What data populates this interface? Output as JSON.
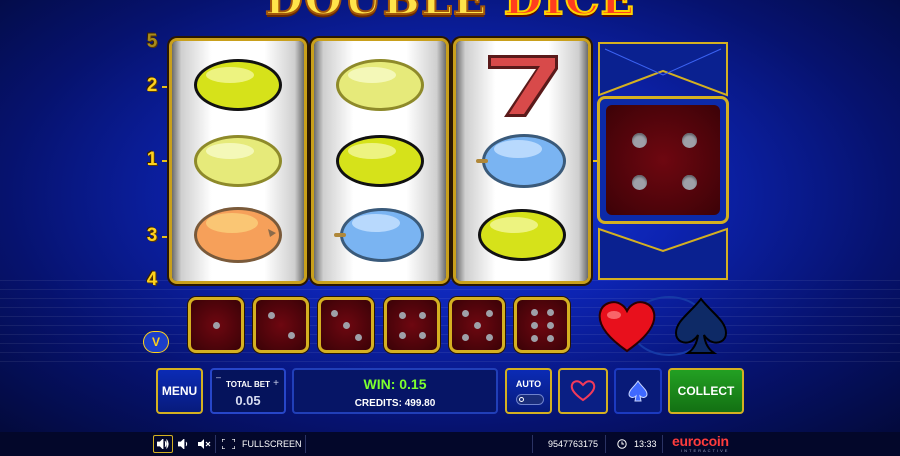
{
  "game": {
    "title_word1": "DOUBLE",
    "title_word2": "DICE"
  },
  "paylines": {
    "left": [
      "5",
      "2",
      "1",
      "3",
      "4"
    ]
  },
  "reels": [
    {
      "symbols": [
        "lemon",
        "lemon",
        "orange"
      ]
    },
    {
      "symbols": [
        "lemon",
        "lemon",
        "plum"
      ]
    },
    {
      "symbols": [
        "seven",
        "plum",
        "lemon"
      ]
    }
  ],
  "big_die": {
    "face": 4
  },
  "dice_row": [
    1,
    2,
    3,
    4,
    5,
    6
  ],
  "suits": [
    "heart",
    "spade"
  ],
  "controls": {
    "menu_label": "MENU",
    "total_bet_label": "TOTAL BET",
    "minus": "–",
    "plus": "+",
    "total_bet_value": "0.05",
    "win_text": "WIN: 0.15",
    "credits_text": "CREDITS: 499.80",
    "auto_label": "AUTO",
    "collect_label": "COLLECT"
  },
  "status_bar": {
    "fullscreen_label": "FULLSCREEN",
    "session_id": "9547763175",
    "clock": "13:33",
    "brand": "eurocoin",
    "brand_sub": "INTERACTIVE"
  },
  "colors": {
    "gold": "#d4b021",
    "win_green": "#7dff2e",
    "collect_green": "#1c8a1c"
  }
}
